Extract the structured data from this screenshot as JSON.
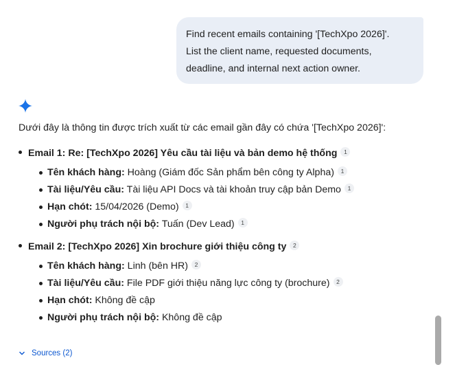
{
  "user_message": {
    "lines": [
      "Find recent emails containing '[TechXpo 2026]'.",
      "List the client name, requested documents,",
      "deadline, and internal next action owner."
    ]
  },
  "response": {
    "intro": "Dưới đây là thông tin được trích xuất từ các email gần đây có chứa '[TechXpo 2026]':",
    "emails": [
      {
        "title": "Email 1: Re: [TechXpo 2026] Yêu cầu tài liệu và bản demo hệ thống",
        "cite": "1",
        "details": [
          {
            "label": "Tên khách hàng:",
            "value": " Hoàng (Giám đốc Sản phẩm bên công ty Alpha)",
            "cite": "1"
          },
          {
            "label": "Tài liệu/Yêu cầu:",
            "value": " Tài liệu API Docs và tài khoản truy cập bản Demo",
            "cite": "1"
          },
          {
            "label": "Hạn chót:",
            "value": " 15/04/2026 (Demo)",
            "cite": "1"
          },
          {
            "label": "Người phụ trách nội bộ:",
            "value": " Tuấn (Dev Lead)",
            "cite": "1"
          }
        ]
      },
      {
        "title": "Email 2: [TechXpo 2026] Xin brochure giới thiệu công ty",
        "cite": "2",
        "details": [
          {
            "label": "Tên khách hàng:",
            "value": " Linh (bên HR)",
            "cite": "2"
          },
          {
            "label": "Tài liệu/Yêu cầu:",
            "value": " File PDF giới thiệu năng lực công ty (brochure)",
            "cite": "2"
          },
          {
            "label": "Hạn chót:",
            "value": " Không đề cập"
          },
          {
            "label": "Người phụ trách nội bộ:",
            "value": " Không đề cập"
          }
        ]
      }
    ],
    "sources_label": "Sources (2)"
  },
  "icons": {
    "assistant": "gemini-sparkle-icon",
    "sources": "chevron-down-icon"
  },
  "colors": {
    "bubble": "#e9eef6",
    "accent": "#0b57d0",
    "sparkle": "#1a73e8"
  }
}
